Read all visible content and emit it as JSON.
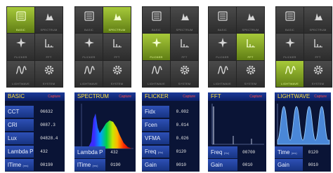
{
  "menus": [
    {
      "tiles": [
        {
          "label": "BASIC",
          "icon": "basic-icon",
          "active": true
        },
        {
          "label": "SPECTRUM",
          "icon": "spectrum-icon",
          "active": false
        },
        {
          "label": "FLICKER",
          "icon": "flicker-icon",
          "active": false
        },
        {
          "label": "FFT",
          "icon": "fft-icon",
          "active": false
        },
        {
          "label": "LIGHTWAVE",
          "icon": "lightwave-icon",
          "active": false
        },
        {
          "label": "SYSTEM",
          "icon": "gear-icon",
          "active": false
        }
      ]
    },
    {
      "tiles": [
        {
          "label": "BASIC",
          "icon": "basic-icon",
          "active": false
        },
        {
          "label": "SPECTRUM",
          "icon": "spectrum-icon",
          "active": true
        },
        {
          "label": "FLICKER",
          "icon": "flicker-icon",
          "active": false
        },
        {
          "label": "FFT",
          "icon": "fft-icon",
          "active": false
        },
        {
          "label": "LIGHTWAVE",
          "icon": "lightwave-icon",
          "active": false
        },
        {
          "label": "SYSTEM",
          "icon": "gear-icon",
          "active": false
        }
      ]
    },
    {
      "tiles": [
        {
          "label": "BASIC",
          "icon": "basic-icon",
          "active": false
        },
        {
          "label": "SPECTRUM",
          "icon": "spectrum-icon",
          "active": false
        },
        {
          "label": "FLICKER",
          "icon": "flicker-icon",
          "active": true
        },
        {
          "label": "FFT",
          "icon": "fft-icon",
          "active": false
        },
        {
          "label": "LIGHTWAVE",
          "icon": "lightwave-icon",
          "active": false
        },
        {
          "label": "SYSTEM",
          "icon": "gear-icon",
          "active": false
        }
      ]
    },
    {
      "tiles": [
        {
          "label": "BASIC",
          "icon": "basic-icon",
          "active": false
        },
        {
          "label": "SPECTRUM",
          "icon": "spectrum-icon",
          "active": false
        },
        {
          "label": "FLICKER",
          "icon": "flicker-icon",
          "active": false
        },
        {
          "label": "FFT",
          "icon": "fft-icon",
          "active": true
        },
        {
          "label": "LIGHTWAVE",
          "icon": "lightwave-icon",
          "active": false
        },
        {
          "label": "SYSTEM",
          "icon": "gear-icon",
          "active": false
        }
      ]
    },
    {
      "tiles": [
        {
          "label": "BASIC",
          "icon": "basic-icon",
          "active": false
        },
        {
          "label": "SPECTRUM",
          "icon": "spectrum-icon",
          "active": false
        },
        {
          "label": "FLICKER",
          "icon": "flicker-icon",
          "active": false
        },
        {
          "label": "FFT",
          "icon": "fft-icon",
          "active": false
        },
        {
          "label": "LIGHTWAVE",
          "icon": "lightwave-icon",
          "active": true
        },
        {
          "label": "SYSTEM",
          "icon": "gear-icon",
          "active": false
        }
      ]
    }
  ],
  "screens": {
    "basic": {
      "title": "BASIC",
      "capture": "Capture",
      "rows": [
        {
          "key": "CCT",
          "val": "06632"
        },
        {
          "key": "CRI",
          "val": "0087.3"
        },
        {
          "key": "Lux",
          "val": "04828.4"
        },
        {
          "key": "Lambda P",
          "val": "432"
        },
        {
          "key": "lTime",
          "unit": "(ms)",
          "val": "00190"
        }
      ]
    },
    "spectrum": {
      "title": "SPECTRUM",
      "capture": "Capture",
      "rows": [
        {
          "key": "Lambda P",
          "val": "432"
        },
        {
          "key": "lTime",
          "unit": "(ms)",
          "val": "0190"
        }
      ]
    },
    "flicker": {
      "title": "FLICKER",
      "capture": "Capture",
      "rows": [
        {
          "key": "Fidx",
          "val": "0.002"
        },
        {
          "key": "Fcen",
          "val": "0.014"
        },
        {
          "key": "VFMA",
          "val": "0.026"
        },
        {
          "key": "Freq",
          "unit": "(Hz)",
          "val": "0120"
        },
        {
          "key": "Gain",
          "val": "0010"
        }
      ]
    },
    "fft": {
      "title": "FFT",
      "capture": "Capture",
      "rows": [
        {
          "key": "Freq",
          "unit": "(Hz)",
          "val": "00700"
        },
        {
          "key": "Gain",
          "val": "0010"
        }
      ]
    },
    "lightwave": {
      "title": "LIGHTWAVE",
      "capture": "Capture",
      "rows": [
        {
          "key": "Time",
          "unit": "(ms)",
          "val": "0120"
        },
        {
          "key": "Gain",
          "val": "0010"
        }
      ]
    }
  },
  "colors": {
    "accent": "#a7c93a",
    "screen_bg": "#0a1436",
    "title": "#ffe23c",
    "capture": "#ff4a4a"
  }
}
